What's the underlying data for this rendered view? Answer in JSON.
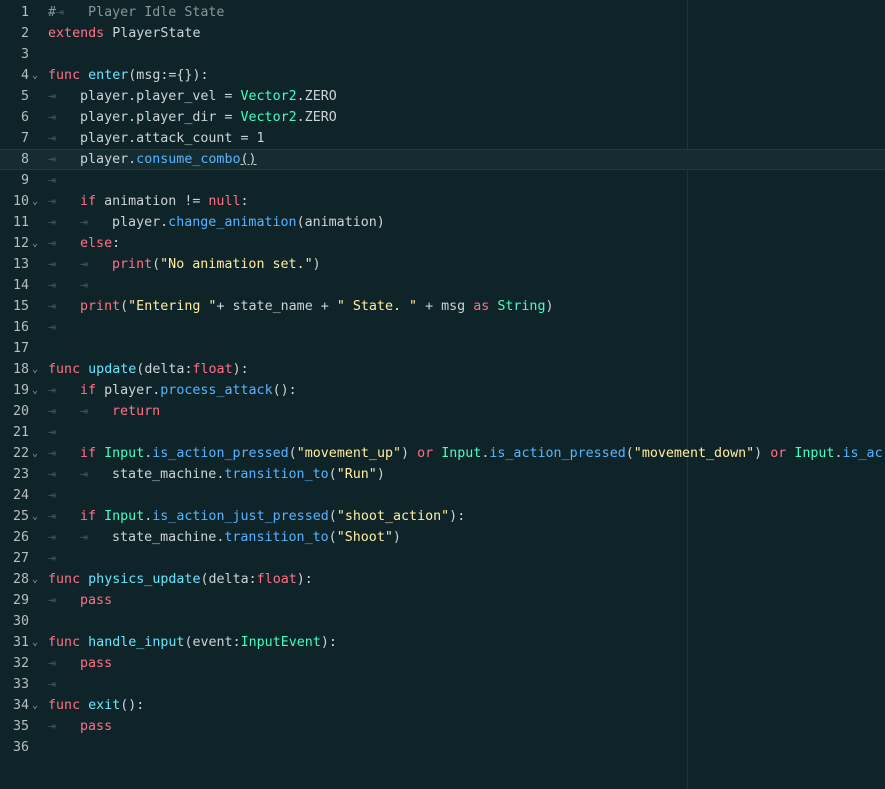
{
  "editor": {
    "lines": [
      {
        "n": "1",
        "fold": "",
        "tokens": [
          [
            "cm",
            "#"
          ],
          [
            "tab",
            "⇥"
          ],
          [
            "cm",
            "Player Idle State"
          ]
        ]
      },
      {
        "n": "2",
        "fold": "",
        "tokens": [
          [
            "kw",
            "extends"
          ],
          [
            "tx",
            " PlayerState"
          ]
        ]
      },
      {
        "n": "3",
        "fold": "",
        "tokens": []
      },
      {
        "n": "4",
        "fold": "⌄",
        "tokens": [
          [
            "kw",
            "func"
          ],
          [
            "tx",
            " "
          ],
          [
            "fn",
            "enter"
          ],
          [
            "tx",
            "(msg:={}):"
          ]
        ]
      },
      {
        "n": "5",
        "fold": "",
        "tokens": [
          [
            "tab",
            "⇥"
          ],
          [
            "tx",
            "player.player_vel = "
          ],
          [
            "ty",
            "Vector2"
          ],
          [
            "tx",
            ".ZERO"
          ]
        ]
      },
      {
        "n": "6",
        "fold": "",
        "tokens": [
          [
            "tab",
            "⇥"
          ],
          [
            "tx",
            "player.player_dir = "
          ],
          [
            "ty",
            "Vector2"
          ],
          [
            "tx",
            ".ZERO"
          ]
        ]
      },
      {
        "n": "7",
        "fold": "",
        "tokens": [
          [
            "tab",
            "⇥"
          ],
          [
            "tx",
            "player.attack_count = 1"
          ]
        ]
      },
      {
        "n": "8",
        "fold": "",
        "tokens": [
          [
            "tab",
            "⇥"
          ],
          [
            "tx",
            "player."
          ],
          [
            "mcall",
            "consume_combo"
          ],
          [
            "ul",
            "()"
          ]
        ]
      },
      {
        "n": "9",
        "fold": "",
        "tokens": [
          [
            "tab",
            "⇥"
          ]
        ]
      },
      {
        "n": "10",
        "fold": "⌄",
        "tokens": [
          [
            "tab",
            "⇥"
          ],
          [
            "kw",
            "if"
          ],
          [
            "tx",
            " animation != "
          ],
          [
            "kw",
            "null"
          ],
          [
            "tx",
            ":"
          ]
        ]
      },
      {
        "n": "11",
        "fold": "",
        "tokens": [
          [
            "tab",
            "⇥"
          ],
          [
            "tab",
            "⇥"
          ],
          [
            "tx",
            "player."
          ],
          [
            "mcall",
            "change_animation"
          ],
          [
            "tx",
            "(animation)"
          ]
        ]
      },
      {
        "n": "12",
        "fold": "⌄",
        "tokens": [
          [
            "tab",
            "⇥"
          ],
          [
            "kw",
            "else"
          ],
          [
            "tx",
            ":"
          ]
        ]
      },
      {
        "n": "13",
        "fold": "",
        "tokens": [
          [
            "tab",
            "⇥"
          ],
          [
            "tab",
            "⇥"
          ],
          [
            "kw",
            "print"
          ],
          [
            "tx",
            "("
          ],
          [
            "str",
            "\"No animation set.\""
          ],
          [
            "tx",
            ")"
          ]
        ]
      },
      {
        "n": "14",
        "fold": "",
        "tokens": [
          [
            "tab",
            "⇥"
          ],
          [
            "tab",
            "⇥"
          ]
        ]
      },
      {
        "n": "15",
        "fold": "",
        "tokens": [
          [
            "tab",
            "⇥"
          ],
          [
            "kw",
            "print"
          ],
          [
            "tx",
            "("
          ],
          [
            "str",
            "\"Entering \""
          ],
          [
            "tx",
            "+ state_name + "
          ],
          [
            "str",
            "\" State. \""
          ],
          [
            "tx",
            " + msg "
          ],
          [
            "kw",
            "as"
          ],
          [
            "tx",
            " "
          ],
          [
            "ty",
            "String"
          ],
          [
            "tx",
            ")"
          ]
        ]
      },
      {
        "n": "16",
        "fold": "",
        "tokens": [
          [
            "tab",
            "⇥"
          ]
        ]
      },
      {
        "n": "17",
        "fold": "",
        "tokens": []
      },
      {
        "n": "18",
        "fold": "⌄",
        "tokens": [
          [
            "kw",
            "func"
          ],
          [
            "tx",
            " "
          ],
          [
            "fn",
            "update"
          ],
          [
            "tx",
            "(delta:"
          ],
          [
            "kw",
            "float"
          ],
          [
            "tx",
            "):"
          ]
        ]
      },
      {
        "n": "19",
        "fold": "⌄",
        "tokens": [
          [
            "tab",
            "⇥"
          ],
          [
            "kw",
            "if"
          ],
          [
            "tx",
            " player."
          ],
          [
            "mcall",
            "process_attack"
          ],
          [
            "tx",
            "():"
          ]
        ]
      },
      {
        "n": "20",
        "fold": "",
        "tokens": [
          [
            "tab",
            "⇥"
          ],
          [
            "tab",
            "⇥"
          ],
          [
            "kw",
            "return"
          ]
        ]
      },
      {
        "n": "21",
        "fold": "",
        "tokens": [
          [
            "tab",
            "⇥"
          ]
        ]
      },
      {
        "n": "22",
        "fold": "⌄",
        "tokens": [
          [
            "tab",
            "⇥"
          ],
          [
            "kw",
            "if"
          ],
          [
            "tx",
            " "
          ],
          [
            "ty",
            "Input"
          ],
          [
            "tx",
            "."
          ],
          [
            "mcall",
            "is_action_pressed"
          ],
          [
            "tx",
            "("
          ],
          [
            "str",
            "\"movement_up\""
          ],
          [
            "tx",
            ") "
          ],
          [
            "kw",
            "or"
          ],
          [
            "tx",
            " "
          ],
          [
            "ty",
            "Input"
          ],
          [
            "tx",
            "."
          ],
          [
            "mcall",
            "is_action_pressed"
          ],
          [
            "tx",
            "("
          ],
          [
            "str",
            "\"movement_down\""
          ],
          [
            "tx",
            ") "
          ],
          [
            "kw",
            "or"
          ],
          [
            "tx",
            " "
          ],
          [
            "ty",
            "Input"
          ],
          [
            "tx",
            "."
          ],
          [
            "mcall",
            "is_ac"
          ]
        ]
      },
      {
        "n": "23",
        "fold": "",
        "tokens": [
          [
            "tab",
            "⇥"
          ],
          [
            "tab",
            "⇥"
          ],
          [
            "tx",
            "state_machine."
          ],
          [
            "mcall",
            "transition_to"
          ],
          [
            "tx",
            "("
          ],
          [
            "str",
            "\"Run\""
          ],
          [
            "tx",
            ")"
          ]
        ]
      },
      {
        "n": "24",
        "fold": "",
        "tokens": [
          [
            "tab",
            "⇥"
          ]
        ]
      },
      {
        "n": "25",
        "fold": "⌄",
        "tokens": [
          [
            "tab",
            "⇥"
          ],
          [
            "kw",
            "if"
          ],
          [
            "tx",
            " "
          ],
          [
            "ty",
            "Input"
          ],
          [
            "tx",
            "."
          ],
          [
            "mcall",
            "is_action_just_pressed"
          ],
          [
            "tx",
            "("
          ],
          [
            "str",
            "\"shoot_action\""
          ],
          [
            "tx",
            "):"
          ]
        ]
      },
      {
        "n": "26",
        "fold": "",
        "tokens": [
          [
            "tab",
            "⇥"
          ],
          [
            "tab",
            "⇥"
          ],
          [
            "tx",
            "state_machine."
          ],
          [
            "mcall",
            "transition_to"
          ],
          [
            "tx",
            "("
          ],
          [
            "str",
            "\"Shoot\""
          ],
          [
            "tx",
            ")"
          ]
        ]
      },
      {
        "n": "27",
        "fold": "",
        "tokens": [
          [
            "tab",
            "⇥"
          ]
        ]
      },
      {
        "n": "28",
        "fold": "⌄",
        "tokens": [
          [
            "kw",
            "func"
          ],
          [
            "tx",
            " "
          ],
          [
            "fn",
            "physics_update"
          ],
          [
            "tx",
            "(delta:"
          ],
          [
            "kw",
            "float"
          ],
          [
            "tx",
            "):"
          ]
        ]
      },
      {
        "n": "29",
        "fold": "",
        "tokens": [
          [
            "tab",
            "⇥"
          ],
          [
            "kw",
            "pass"
          ]
        ]
      },
      {
        "n": "30",
        "fold": "",
        "tokens": []
      },
      {
        "n": "31",
        "fold": "⌄",
        "tokens": [
          [
            "kw",
            "func"
          ],
          [
            "tx",
            " "
          ],
          [
            "fn",
            "handle_input"
          ],
          [
            "tx",
            "(event:"
          ],
          [
            "ty",
            "InputEvent"
          ],
          [
            "tx",
            "):"
          ]
        ]
      },
      {
        "n": "32",
        "fold": "",
        "tokens": [
          [
            "tab",
            "⇥"
          ],
          [
            "kw",
            "pass"
          ]
        ]
      },
      {
        "n": "33",
        "fold": "",
        "tokens": [
          [
            "tab",
            "⇥"
          ]
        ]
      },
      {
        "n": "34",
        "fold": "⌄",
        "tokens": [
          [
            "kw",
            "func"
          ],
          [
            "tx",
            " "
          ],
          [
            "fn",
            "exit"
          ],
          [
            "tx",
            "():"
          ]
        ]
      },
      {
        "n": "35",
        "fold": "",
        "tokens": [
          [
            "tab",
            "⇥"
          ],
          [
            "kw",
            "pass"
          ]
        ]
      },
      {
        "n": "36",
        "fold": "",
        "tokens": []
      }
    ],
    "current_line": "8",
    "colors": {
      "background": "#0f2428",
      "keyword": "#ff7085",
      "function": "#66e6ff",
      "method_call": "#57b3ff",
      "type": "#42ffc2",
      "string": "#ffeda1",
      "comment": "#8a9699",
      "text": "#cdd3d6"
    }
  }
}
